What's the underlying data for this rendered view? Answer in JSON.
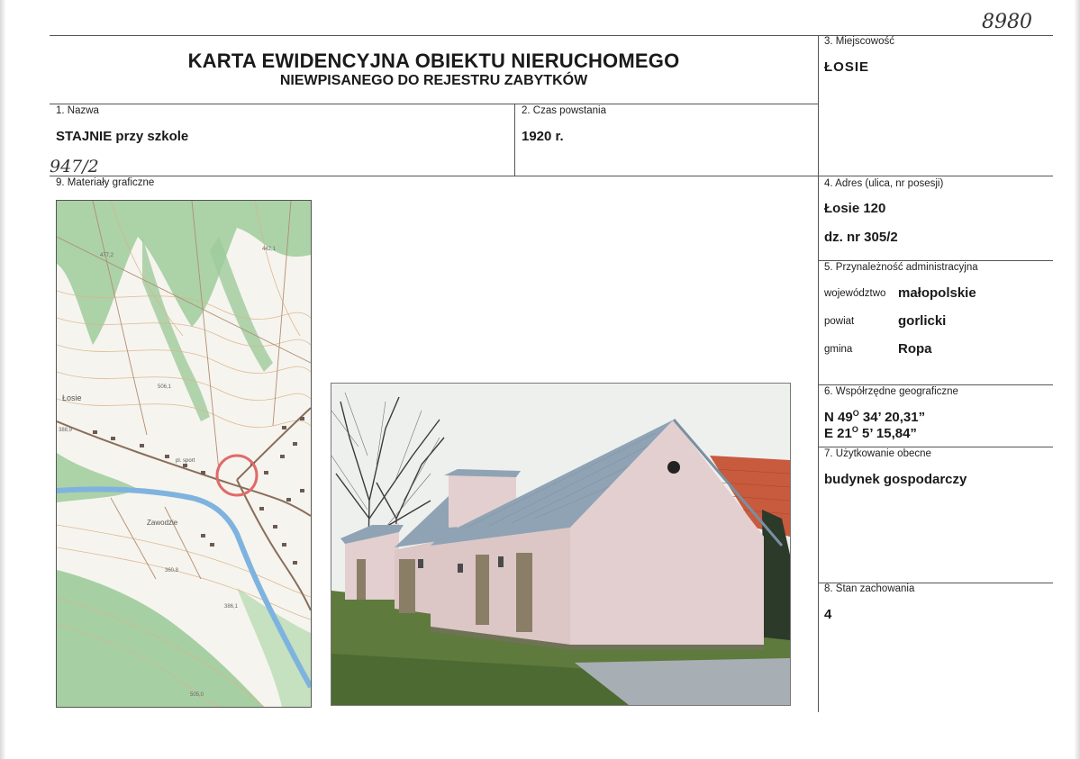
{
  "handwritten": {
    "top_right": "8980",
    "left_ref": "947/2"
  },
  "header": {
    "title": "KARTA EWIDENCYJNA OBIEKTU NIERUCHOMEGO",
    "subtitle": "NIEWPISANEGO DO REJESTRU ZABYTKÓW"
  },
  "fields": {
    "name": {
      "label": "1. Nazwa",
      "value": "STAJNIE przy szkole"
    },
    "date": {
      "label": "2. Czas powstania",
      "value": "1920 r."
    },
    "locality": {
      "label": "3. Miejscowość",
      "value": "ŁOSIE"
    },
    "address": {
      "label": "4. Adres (ulica, nr posesji)",
      "line1": "Łosie 120",
      "line2": "dz. nr 305/2"
    },
    "admin": {
      "label": "5. Przynależność administracyjna",
      "voivodeship_label": "województwo",
      "voivodeship": "małopolskie",
      "county_label": "powiat",
      "county": "gorlicki",
      "commune_label": "gmina",
      "commune": "Ropa"
    },
    "coords": {
      "label": "6. Współrzędne geograficzne",
      "lat_prefix": "N 49",
      "lat_deg": "O",
      "lat_rest": " 34’ 20,31”",
      "lon_prefix": "E 21",
      "lon_deg": "O",
      "lon_rest": " 5’ 15,84”"
    },
    "usage": {
      "label": "7. Użytkowanie obecne",
      "value": "budynek gospodarczy"
    },
    "condition": {
      "label": "8. Stan zachowania",
      "value": "4"
    },
    "graphics": {
      "label": "9. Materiały graficzne"
    }
  },
  "map": {
    "place_labels": [
      "Łosie",
      "Zawodzie",
      "pl. sport"
    ],
    "elevations": [
      "477,2",
      "442,1",
      "506,1",
      "388,9",
      "360,8",
      "386,1",
      "505,0"
    ],
    "colors": {
      "forest": "#9fcb9b",
      "water": "#7fb3df",
      "roads": "#8a6e5a",
      "marker": "#e06a6a"
    }
  },
  "photo": {
    "colors": {
      "sky": "#eef0ee",
      "wall": "#e3cfcf",
      "roof": "#8fa3b4",
      "grass": "#5e7a3c",
      "tiles": "#c85a3e"
    }
  }
}
